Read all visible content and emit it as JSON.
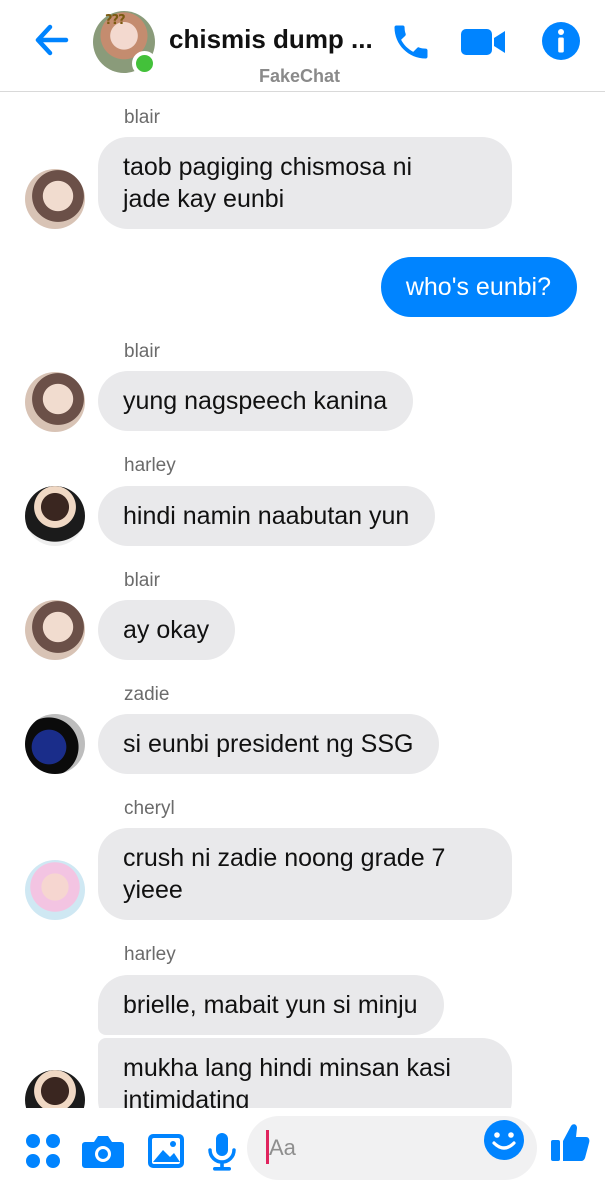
{
  "header": {
    "title": "chismis dump ...",
    "subtitle": "FakeChat",
    "avatar_marks": "???",
    "accent_color": "#0084ff",
    "online_color": "#43c13a",
    "icons": [
      "arrow-left-icon",
      "phone-icon",
      "video-camera-icon",
      "info-icon"
    ]
  },
  "messages": [
    {
      "sender": "blair",
      "text_lines": [
        "taob pagiging chismosa ni",
        "jade kay eunbi"
      ],
      "direction": "incoming"
    },
    {
      "sender": "",
      "text_lines": [
        "who's eunbi?"
      ],
      "direction": "outgoing"
    },
    {
      "sender": "blair",
      "text_lines": [
        "yung nagspeech kanina"
      ],
      "direction": "incoming"
    },
    {
      "sender": "harley",
      "text_lines": [
        "hindi namin naabutan yun"
      ],
      "direction": "incoming"
    },
    {
      "sender": "blair",
      "text_lines": [
        "ay okay"
      ],
      "direction": "incoming"
    },
    {
      "sender": "zadie",
      "text_lines": [
        "si eunbi president ng SSG"
      ],
      "direction": "incoming"
    },
    {
      "sender": "cheryl",
      "text_lines": [
        "crush ni zadie noong grade 7",
        "yieee"
      ],
      "direction": "incoming"
    },
    {
      "sender": "harley",
      "text_lines": [
        "brielle, mabait yun si minju"
      ],
      "direction": "incoming"
    },
    {
      "sender": "",
      "text_lines": [
        "mukha lang hindi minsan kasi",
        "intimidating"
      ],
      "direction": "incoming"
    }
  ],
  "composer": {
    "placeholder": "Aa",
    "icons": [
      "apps-grid-icon",
      "camera-icon",
      "image-icon",
      "microphone-icon",
      "emoji-icon",
      "thumbs-up-icon"
    ]
  }
}
